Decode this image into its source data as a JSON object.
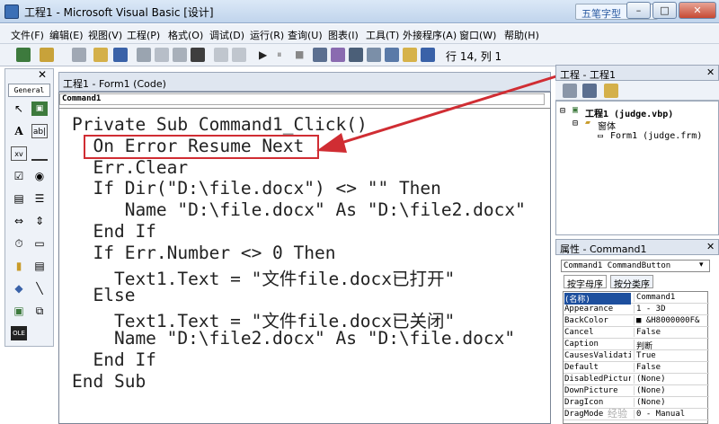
{
  "window": {
    "title": "工程1 - Microsoft Visual Basic [设计]",
    "ime": "五笔字型",
    "min": "–",
    "max": "□",
    "close": "✕"
  },
  "menu": [
    "文件(F)",
    "编辑(E)",
    "视图(V)",
    "工程(P)",
    "格式(O)",
    "调试(D)",
    "运行(R)",
    "查询(U)",
    "图表(I)",
    "工具(T)",
    "外接程序(A)",
    "窗口(W)",
    "帮助(H)"
  ],
  "toolbar": {
    "position": "行 14, 列 1"
  },
  "toolbox": {
    "close": "✕",
    "tab": "General"
  },
  "code_window": {
    "title": "工程1 - Form1 (Code)",
    "object": "Command1",
    "lines": [
      "Private Sub Command1_Click()",
      "  On Error Resume Next",
      "  Err.Clear",
      "  If Dir(\"D:\\file.docx\") <> \"\" Then",
      "     Name \"D:\\file.docx\" As \"D:\\file2.docx\"",
      "  End If",
      "  If Err.Number <> 0 Then",
      "    Text1.Text = \"文件file.docx已打开\"",
      "  Else",
      "    Text1.Text = \"文件file.docx已关闭\"",
      "    Name \"D:\\file2.docx\" As \"D:\\file.docx\"",
      "  End If",
      "End Sub"
    ]
  },
  "project": {
    "title": "工程 - 工程1",
    "root": "工程1 (judge.vbp)",
    "folder": "窗体",
    "form": "Form1 (judge.frm)",
    "close": "✕"
  },
  "properties": {
    "title": "属性 - Command1",
    "close": "✕",
    "object": "Command1 CommandButton",
    "tabs": [
      "按字母序",
      "按分类序"
    ],
    "rows": [
      [
        "(名称)",
        "Command1"
      ],
      [
        "Appearance",
        "1 - 3D"
      ],
      [
        "BackColor",
        "■ &H8000000F&"
      ],
      [
        "Cancel",
        "False"
      ],
      [
        "Caption",
        "判断"
      ],
      [
        "CausesValidation",
        "True"
      ],
      [
        "Default",
        "False"
      ],
      [
        "DisabledPicture",
        "(None)"
      ],
      [
        "DownPicture",
        "(None)"
      ],
      [
        "DragIcon",
        "(None)"
      ],
      [
        "DragMode",
        "0 - Manual"
      ]
    ]
  },
  "watermark": "经验"
}
